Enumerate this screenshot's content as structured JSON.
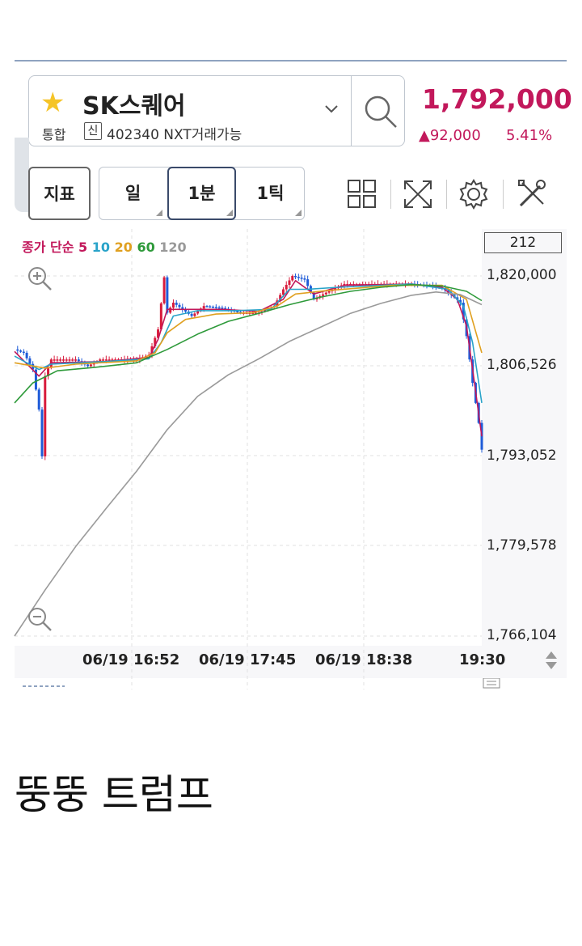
{
  "header": {
    "stock_name": "SK스퀘어",
    "market": "통합",
    "credit_badge": "신",
    "code_info": "402340 NXT거래가능",
    "price": "1,792,000",
    "change": "▲92,000",
    "change_pct": "5.41%",
    "accent_color": "#c2185b"
  },
  "toolbar": {
    "indicator_label": "지표",
    "periods": [
      "일",
      "1분",
      "1틱"
    ],
    "selected_period": "1분",
    "icons": [
      "grid-layout-icon",
      "fullscreen-icon",
      "settings-gear-icon",
      "tools-icon"
    ]
  },
  "chart_legend": {
    "label": "종가 단순",
    "periods": [
      "5",
      "10",
      "20",
      "60",
      "120"
    ]
  },
  "count_box": "212",
  "caption": "뚱뚱 트럼프",
  "chart_data": {
    "type": "line",
    "y_ticks": [
      "1,820,000",
      "1,806,526",
      "1,793,052",
      "1,779,578",
      "1,766,104"
    ],
    "x_ticks": [
      "06/19 16:52",
      "06/19 17:45",
      "06/19 18:38",
      "19:30"
    ],
    "ylim": [
      1766104,
      1820000
    ],
    "series": [
      {
        "name": "5",
        "color": "#c2185b"
      },
      {
        "name": "10",
        "color": "#29a3c9"
      },
      {
        "name": "20",
        "color": "#e0a020"
      },
      {
        "name": "60",
        "color": "#2e9a3a"
      },
      {
        "name": "120",
        "color": "#9a9a9a"
      }
    ],
    "close_path": [
      [
        0,
        1809000
      ],
      [
        3,
        1808500
      ],
      [
        6,
        1806000
      ],
      [
        8,
        1800000
      ],
      [
        9,
        1793000
      ],
      [
        10,
        1805000
      ],
      [
        12,
        1807500
      ],
      [
        20,
        1807500
      ],
      [
        24,
        1806500
      ],
      [
        28,
        1807500
      ],
      [
        40,
        1807500
      ],
      [
        44,
        1808200
      ],
      [
        47,
        1812000
      ],
      [
        49,
        1819800
      ],
      [
        50,
        1814500
      ],
      [
        52,
        1816000
      ],
      [
        55,
        1815000
      ],
      [
        58,
        1814000
      ],
      [
        62,
        1815500
      ],
      [
        68,
        1815200
      ],
      [
        74,
        1814500
      ],
      [
        80,
        1814500
      ],
      [
        85,
        1815500
      ],
      [
        88,
        1818000
      ],
      [
        91,
        1820000
      ],
      [
        95,
        1819500
      ],
      [
        98,
        1816500
      ],
      [
        102,
        1817500
      ],
      [
        108,
        1818800
      ],
      [
        116,
        1818800
      ],
      [
        122,
        1818800
      ],
      [
        130,
        1818800
      ],
      [
        136,
        1818600
      ],
      [
        140,
        1818200
      ],
      [
        143,
        1817200
      ],
      [
        146,
        1816000
      ],
      [
        148,
        1811000
      ],
      [
        150,
        1804000
      ],
      [
        152,
        1798000
      ],
      [
        153,
        1794000
      ]
    ],
    "ma_values": {
      "5": [
        [
          0,
          1808700
        ],
        [
          8,
          1805000
        ],
        [
          12,
          1807000
        ],
        [
          30,
          1807200
        ],
        [
          44,
          1807800
        ],
        [
          47,
          1810500
        ],
        [
          50,
          1815000
        ],
        [
          56,
          1815000
        ],
        [
          68,
          1815000
        ],
        [
          80,
          1814700
        ],
        [
          88,
          1816500
        ],
        [
          92,
          1819300
        ],
        [
          98,
          1817300
        ],
        [
          108,
          1818600
        ],
        [
          130,
          1818800
        ],
        [
          140,
          1818300
        ],
        [
          145,
          1816500
        ],
        [
          148,
          1812500
        ],
        [
          150,
          1806000
        ],
        [
          153,
          1796000
        ]
      ],
      "10": [
        [
          0,
          1808000
        ],
        [
          8,
          1806000
        ],
        [
          12,
          1806800
        ],
        [
          30,
          1807200
        ],
        [
          44,
          1807600
        ],
        [
          48,
          1810000
        ],
        [
          52,
          1814000
        ],
        [
          60,
          1814800
        ],
        [
          72,
          1814800
        ],
        [
          84,
          1815000
        ],
        [
          90,
          1818000
        ],
        [
          96,
          1818000
        ],
        [
          106,
          1818300
        ],
        [
          130,
          1818800
        ],
        [
          142,
          1818000
        ],
        [
          147,
          1815500
        ],
        [
          150,
          1810000
        ],
        [
          153,
          1801000
        ]
      ],
      "20": [
        [
          0,
          1807000
        ],
        [
          10,
          1806200
        ],
        [
          20,
          1806800
        ],
        [
          40,
          1807300
        ],
        [
          46,
          1808500
        ],
        [
          50,
          1811500
        ],
        [
          56,
          1813500
        ],
        [
          66,
          1814300
        ],
        [
          78,
          1814500
        ],
        [
          86,
          1815500
        ],
        [
          92,
          1817300
        ],
        [
          102,
          1817800
        ],
        [
          124,
          1818600
        ],
        [
          140,
          1818600
        ],
        [
          148,
          1816500
        ],
        [
          153,
          1808500
        ]
      ],
      "60": [
        [
          0,
          1801000
        ],
        [
          6,
          1804000
        ],
        [
          14,
          1805800
        ],
        [
          26,
          1806300
        ],
        [
          40,
          1807000
        ],
        [
          50,
          1809000
        ],
        [
          60,
          1811300
        ],
        [
          70,
          1813200
        ],
        [
          80,
          1814400
        ],
        [
          90,
          1815700
        ],
        [
          100,
          1816800
        ],
        [
          110,
          1817700
        ],
        [
          120,
          1818300
        ],
        [
          130,
          1818700
        ],
        [
          140,
          1818500
        ],
        [
          148,
          1817700
        ],
        [
          153,
          1816300
        ]
      ],
      "120": [
        [
          0,
          1766104
        ],
        [
          10,
          1773000
        ],
        [
          20,
          1779500
        ],
        [
          30,
          1785200
        ],
        [
          40,
          1790800
        ],
        [
          50,
          1797000
        ],
        [
          60,
          1802000
        ],
        [
          70,
          1805200
        ],
        [
          80,
          1807600
        ],
        [
          90,
          1810200
        ],
        [
          100,
          1812300
        ],
        [
          110,
          1814400
        ],
        [
          120,
          1815900
        ],
        [
          130,
          1817100
        ],
        [
          138,
          1817600
        ],
        [
          146,
          1817200
        ],
        [
          153,
          1815700
        ]
      ]
    }
  }
}
